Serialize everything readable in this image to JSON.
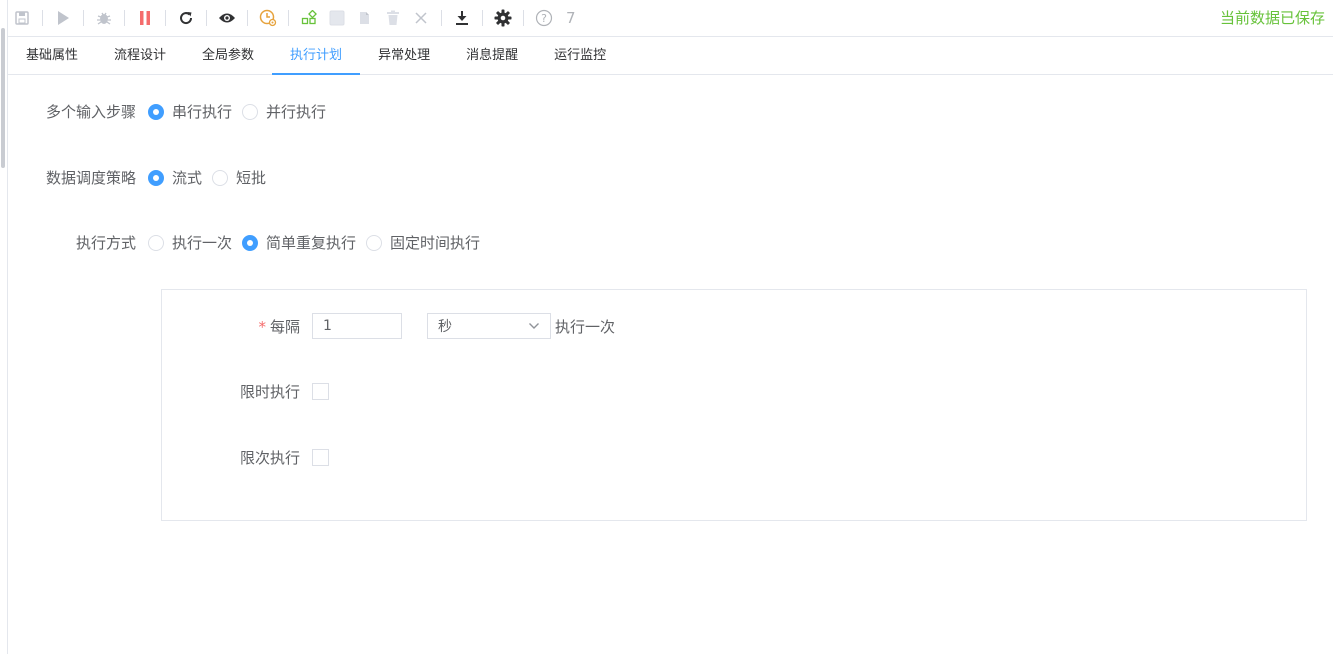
{
  "toolbar": {
    "icons": [
      "save-icon",
      "run-icon",
      "debug-icon",
      "stop-icon",
      "refresh-icon",
      "preview-icon",
      "schedule-icon",
      "component-icon",
      "square-icon",
      "copy-icon",
      "delete-icon",
      "close-icon",
      "download-icon",
      "settings-icon",
      "help-icon"
    ],
    "count": "7",
    "status": "当前数据已保存",
    "colors": {
      "status": "#67c23a",
      "stop": "#f56c6c",
      "schedule": "#e6a23c",
      "component": "#67c23a",
      "disabled": "#c0c4cc",
      "active": "#303133"
    }
  },
  "tabs": [
    {
      "label": "基础属性"
    },
    {
      "label": "流程设计"
    },
    {
      "label": "全局参数"
    },
    {
      "label": "执行计划",
      "active": true
    },
    {
      "label": "异常处理"
    },
    {
      "label": "消息提醒"
    },
    {
      "label": "运行监控"
    }
  ],
  "form": {
    "multi_input": {
      "label": "多个输入步骤",
      "options": [
        "串行执行",
        "并行执行"
      ],
      "selected": "串行执行"
    },
    "dispatch": {
      "label": "数据调度策略",
      "options": [
        "流式",
        "短批"
      ],
      "selected": "流式"
    },
    "exec_mode": {
      "label": "执行方式",
      "options": [
        "执行一次",
        "简单重复执行",
        "固定时间执行"
      ],
      "selected": "简单重复执行"
    },
    "repeat": {
      "required_mark": "*",
      "interval_label": "每隔",
      "interval_value": "1",
      "unit": "秒",
      "suffix": "执行一次",
      "time_limit_label": "限时执行",
      "time_limit_checked": false,
      "count_limit_label": "限次执行",
      "count_limit_checked": false
    }
  },
  "accent_color": "#409eff"
}
